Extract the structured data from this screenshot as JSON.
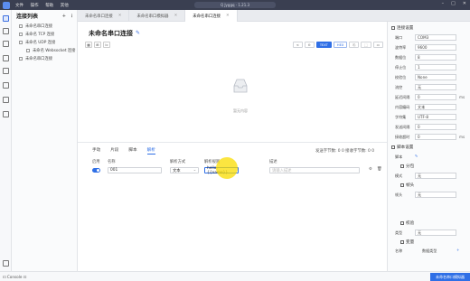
{
  "titlebar": {
    "menu": [
      "文件",
      "操作",
      "帮助",
      "其他"
    ],
    "search": "Q Jyggq · 1.21.3"
  },
  "sidebar": {
    "title": "连接列表",
    "items": [
      {
        "label": "未命名串口连接",
        "sub": false
      },
      {
        "label": "未命名 TCP 连接",
        "sub": false
      },
      {
        "label": "未命名 UDP 连接",
        "sub": false
      },
      {
        "label": "未命名 Websocket 连接",
        "sub": true
      },
      {
        "label": "未命名串口连接",
        "sub": false
      }
    ]
  },
  "tabs": [
    {
      "label": "未命名串口连接",
      "active": false
    },
    {
      "label": "未命名串口模拟器",
      "active": false
    },
    {
      "label": "未命名串口连接",
      "active": true
    }
  ],
  "main": {
    "title": "未命名串口连接",
    "toolbar_left": [
      "▦",
      "⊞",
      "lc"
    ],
    "toolbar_right": [
      "<",
      "⊙",
      "TEXT",
      "HEX",
      "⎘",
      "⬚",
      "▭"
    ],
    "empty_text": "暂无内容",
    "subtabs": [
      "手动",
      "片段",
      "脚本",
      "解析"
    ],
    "active_subtab": "解析",
    "stats": "发送字节数: 0 0 接收字节数: 0 0",
    "columns": [
      "启用",
      "名称",
      "解析方式",
      "解析规则",
      "描述"
    ],
    "row": {
      "name": "001",
      "method": "文本",
      "rule": "hello, {{name}}",
      "desc_placeholder": "请输入描述"
    }
  },
  "rpanel": {
    "section_connection": "连接设置",
    "port_label": "端口",
    "port_value": "COM3",
    "baud_label": "波特率",
    "baud_value": "9600",
    "databits_label": "数据位",
    "databits_value": "8",
    "stopbits_label": "停止位",
    "stopbits_value": "1",
    "parity_label": "校验位",
    "parity_value": "None",
    "flow_label": "流控",
    "flow_value": "无",
    "delay_label": "延迟间隔",
    "delay_value": "0",
    "delay_unit": "ms",
    "encoding_label": "内容编码",
    "encoding_value": "文本",
    "charset_label": "字符集",
    "charset_value": "UTF-8",
    "sendlimit_label": "发送间隔",
    "sendlimit_value": "0",
    "recvtimeout_label": "接收超时",
    "recvtimeout_value": "0",
    "recvtimeout_unit": "ms",
    "section_script": "脚本设置",
    "script_label": "脚本",
    "script_value": "",
    "section_split": "分包",
    "split_label": "模式",
    "split_value": "无",
    "section_frame": "帧头",
    "frame_label": "帧头",
    "frame_value": "无",
    "section_checksum": "校验",
    "checksum_label": "类型",
    "checksum_value": "无",
    "section_vars": "变量",
    "var_col_name": "名称",
    "var_col_type": "数据类型"
  },
  "status": {
    "left": "⊡ Console  ⊡",
    "right": "未命名串口模拟器"
  },
  "colors": {
    "accent": "#2f6fe6",
    "titlebar": "#3a3f51"
  }
}
